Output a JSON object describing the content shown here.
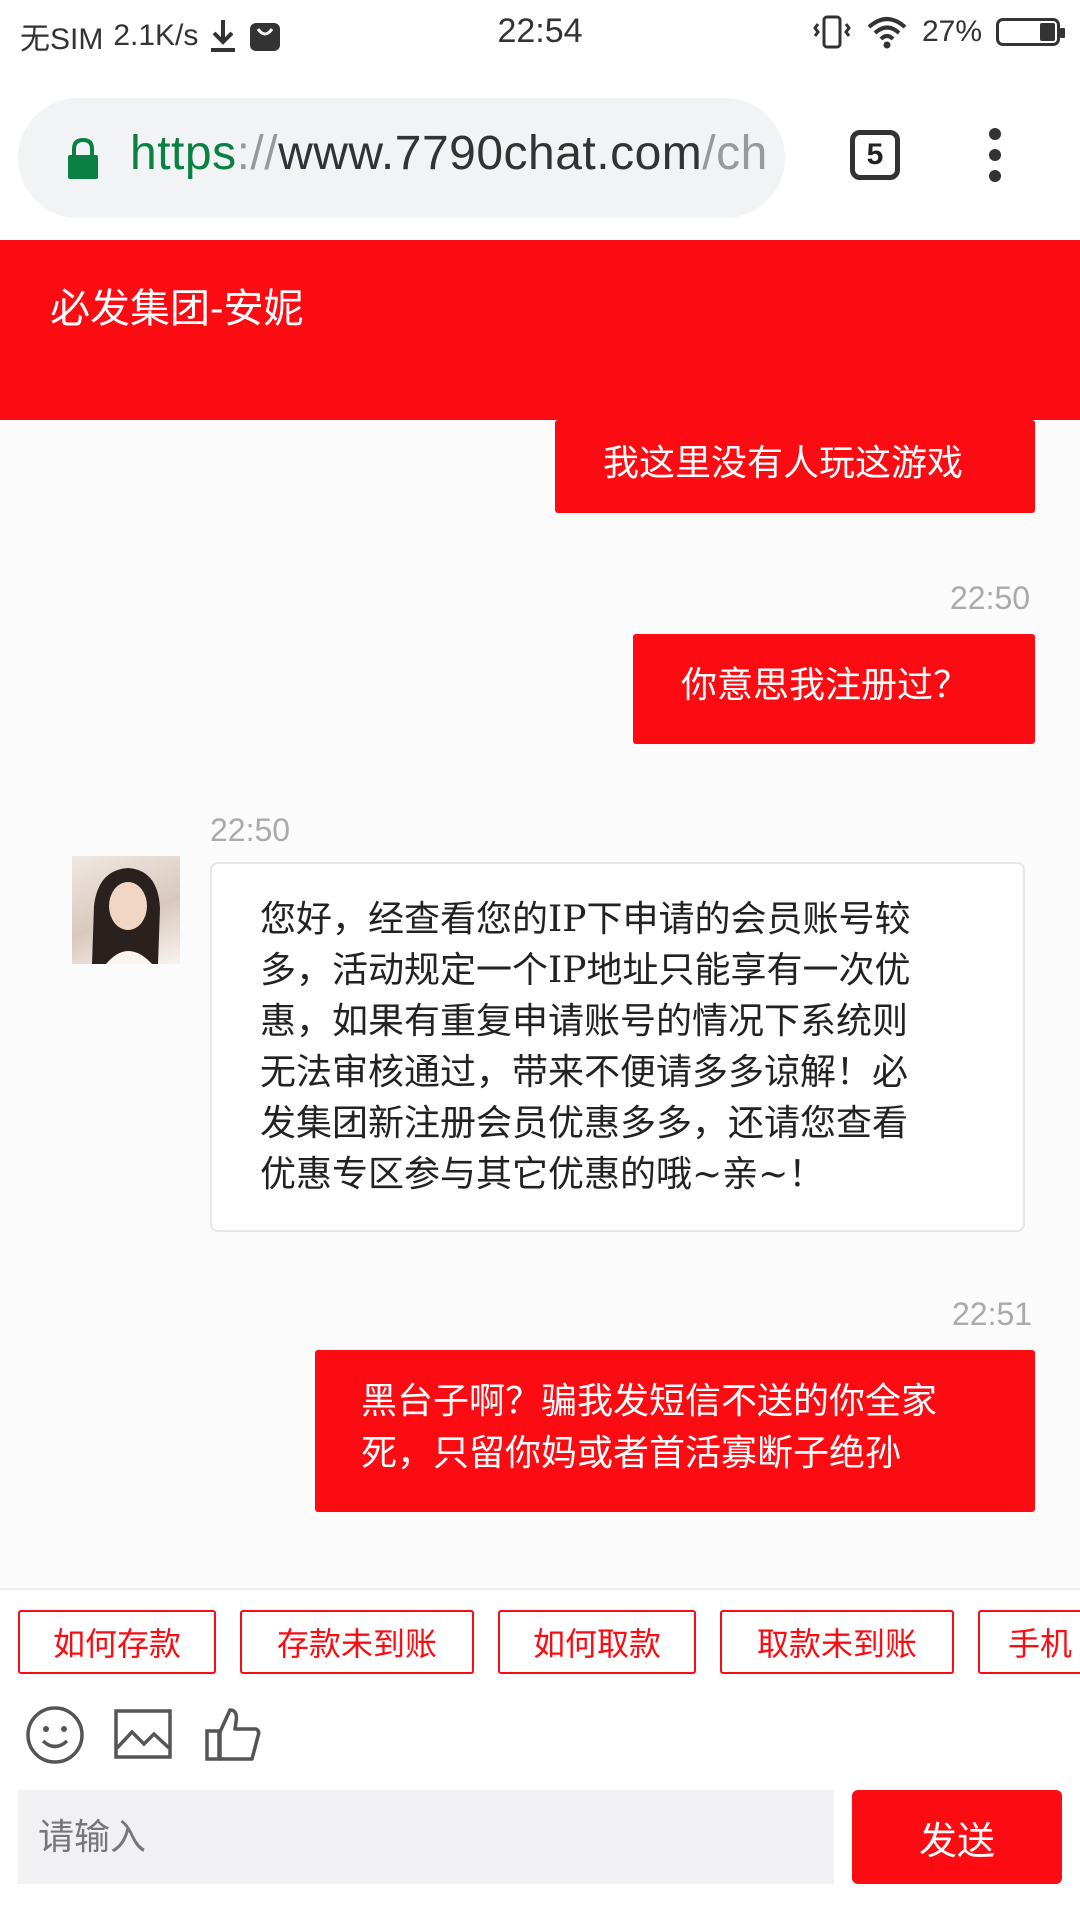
{
  "status_bar": {
    "carrier": "无SIM",
    "speed": "2.1K/s",
    "time": "22:54",
    "battery": "27%",
    "battery_level": 0.27,
    "icons": [
      "download-icon",
      "shopping-bag-icon",
      "vibrate-icon",
      "wifi-icon",
      "battery-icon"
    ]
  },
  "browser": {
    "url_scheme": "https",
    "url_separator": "://",
    "url_host": "www.7790chat.com",
    "url_rest": "/ch",
    "tab_count": "5"
  },
  "chat": {
    "title": "必发集团-安妮",
    "messages": [
      {
        "side": "out",
        "text": "我这里没有人玩这游戏"
      },
      {
        "side": "out",
        "time": "22:50",
        "text": "你意思我注册过？"
      },
      {
        "side": "in",
        "time": "22:50",
        "lines": [
          "您好，经查看您的IP下申请的会员账号较",
          "多，活动规定一个IP地址只能享有一次优",
          "惠，如果有重复申请账号的情况下系统则",
          "无法审核通过，带来不便请多多谅解！必",
          "发集团新注册会员优惠多多，还请您查看",
          "优惠专区参与其它优惠的哦~亲~！"
        ]
      },
      {
        "side": "out",
        "time": "22:51",
        "lines": [
          "黑台子啊？骗我发短信不送的你全家",
          "死，只留你妈或者首活寡断子绝孙"
        ]
      }
    ]
  },
  "quick_replies": [
    "如何存款",
    "存款未到账",
    "如何取款",
    "取款未到账",
    "手机"
  ],
  "toolbar": {
    "icons": [
      "emoji-icon",
      "image-icon",
      "thumbs-up-icon"
    ]
  },
  "input": {
    "placeholder": "请输入",
    "send_label": "发送"
  },
  "colors": {
    "brand_red": "#fd0b12",
    "url_green": "#0b8043"
  }
}
